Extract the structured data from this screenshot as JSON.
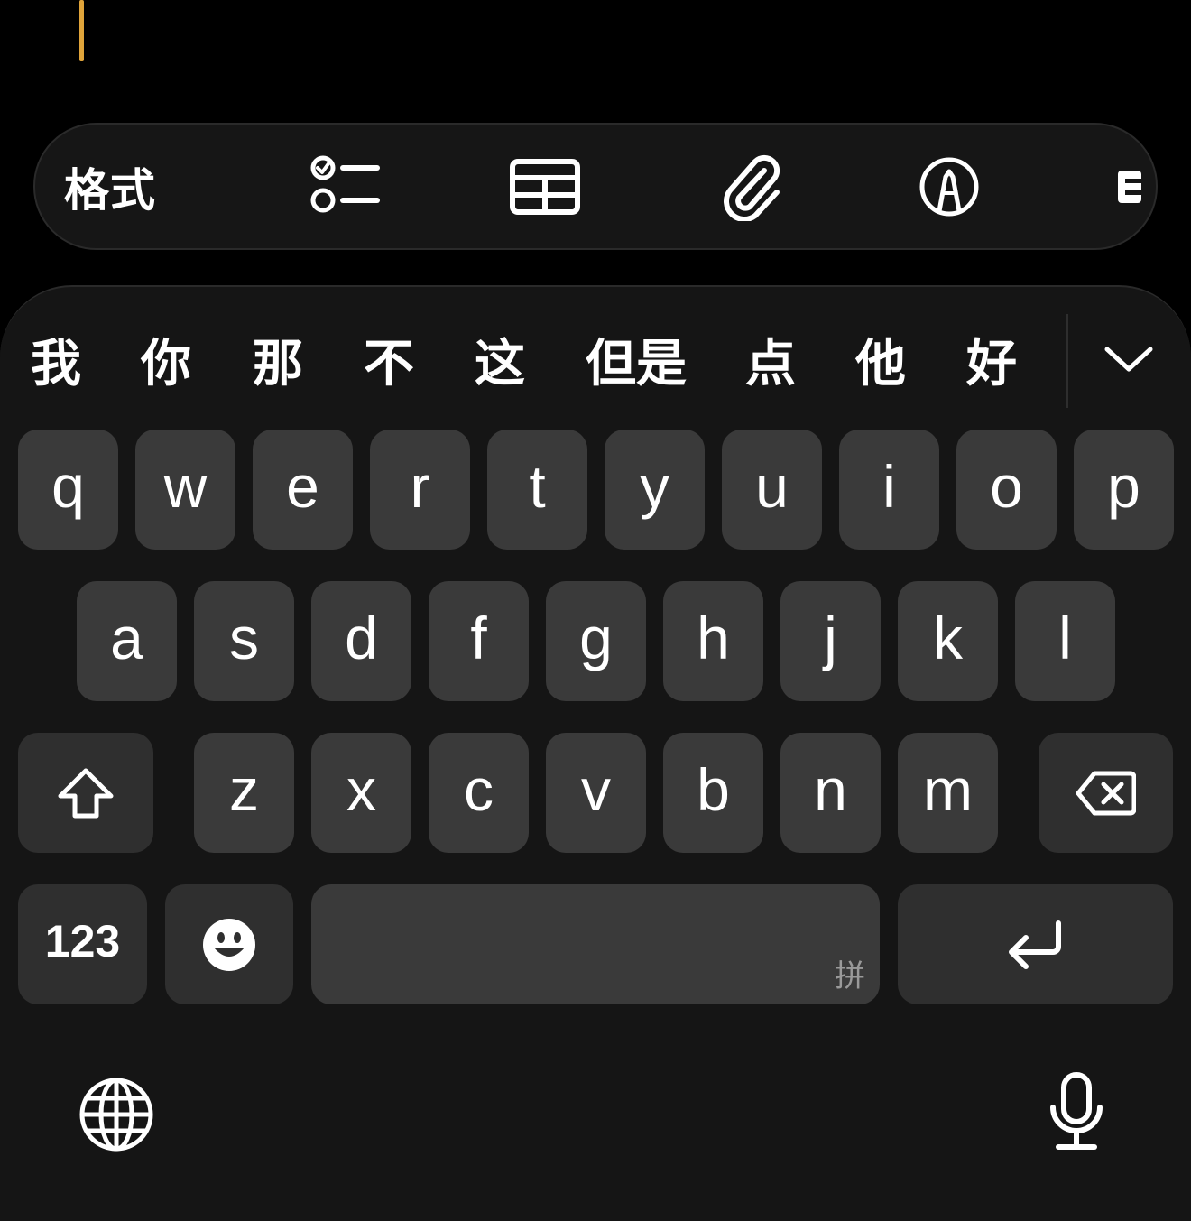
{
  "toolbar": {
    "format_label": "格式",
    "icons": [
      "checklist-icon",
      "table-icon",
      "paperclip-icon",
      "markup-pen-icon",
      "more-icon"
    ]
  },
  "candidates": [
    "我",
    "你",
    "那",
    "不",
    "这",
    "但是",
    "点",
    "他",
    "好"
  ],
  "keyboard": {
    "row1": [
      "q",
      "w",
      "e",
      "r",
      "t",
      "y",
      "u",
      "i",
      "o",
      "p"
    ],
    "row2": [
      "a",
      "s",
      "d",
      "f",
      "g",
      "h",
      "j",
      "k",
      "l"
    ],
    "row3": [
      "z",
      "x",
      "c",
      "v",
      "b",
      "n",
      "m"
    ],
    "numbers_label": "123",
    "space_hint": "拼"
  },
  "colors": {
    "caret": "#e0a43a",
    "key_bg": "#3a3a3a",
    "keyboard_bg": "#151515"
  }
}
